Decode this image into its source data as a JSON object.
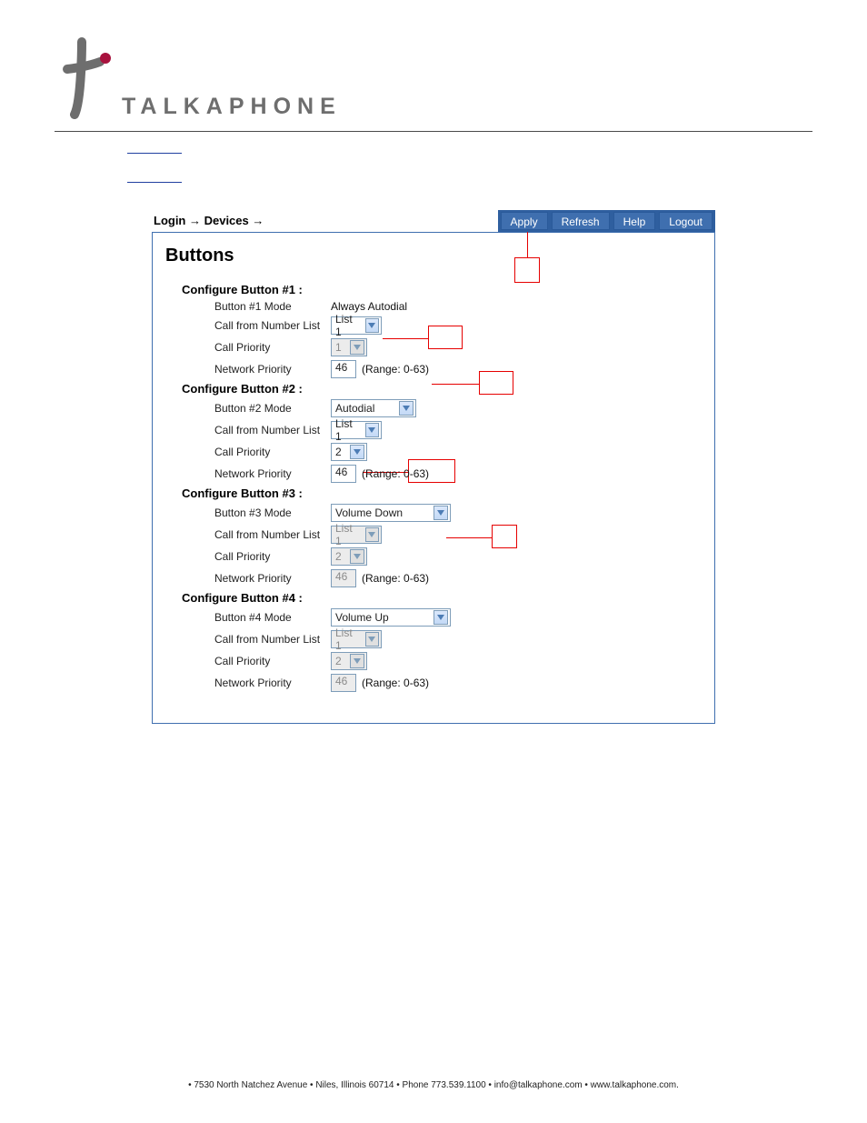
{
  "brand": {
    "name": "TALKAPHONE"
  },
  "breadcrumb": "Login → Devices →",
  "toolbar": {
    "apply": "Apply",
    "refresh": "Refresh",
    "help": "Help",
    "logout": "Logout"
  },
  "panel": {
    "title": "Buttons",
    "sections": [
      {
        "title": "Configure Button #1 :",
        "mode_label": "Button #1 Mode",
        "mode_value": "Always Autodial",
        "mode_is_select": false,
        "list_label": "Call from Number List",
        "list_value": "List 1",
        "list_disabled": false,
        "priority_label": "Call Priority",
        "priority_value": "1",
        "priority_disabled": true,
        "net_label": "Network Priority",
        "net_value": "46",
        "net_disabled": false,
        "range": "(Range: 0-63)"
      },
      {
        "title": "Configure Button #2 :",
        "mode_label": "Button #2 Mode",
        "mode_value": "Autodial",
        "mode_is_select": true,
        "mode_width": 94,
        "list_label": "Call from Number List",
        "list_value": "List 1",
        "list_disabled": false,
        "priority_label": "Call Priority",
        "priority_value": "2",
        "priority_disabled": false,
        "net_label": "Network Priority",
        "net_value": "46",
        "net_disabled": false,
        "range": "(Range: 0-63)"
      },
      {
        "title": "Configure Button #3 :",
        "mode_label": "Button #3 Mode",
        "mode_value": "Volume Down",
        "mode_is_select": true,
        "mode_width": 132,
        "list_label": "Call from Number List",
        "list_value": "List 1",
        "list_disabled": true,
        "priority_label": "Call Priority",
        "priority_value": "2",
        "priority_disabled": true,
        "net_label": "Network Priority",
        "net_value": "46",
        "net_disabled": true,
        "range": "(Range: 0-63)"
      },
      {
        "title": "Configure Button #4 :",
        "mode_label": "Button #4 Mode",
        "mode_value": "Volume Up",
        "mode_is_select": true,
        "mode_width": 132,
        "list_label": "Call from Number List",
        "list_value": "List 1",
        "list_disabled": true,
        "priority_label": "Call Priority",
        "priority_value": "2",
        "priority_disabled": true,
        "net_label": "Network Priority",
        "net_value": "46",
        "net_disabled": true,
        "range": "(Range: 0-63)"
      }
    ]
  },
  "footer": "• 7530 North Natchez Avenue • Niles, Illinois 60714 • Phone 773.539.1100 • info@talkaphone.com • www.talkaphone.com."
}
